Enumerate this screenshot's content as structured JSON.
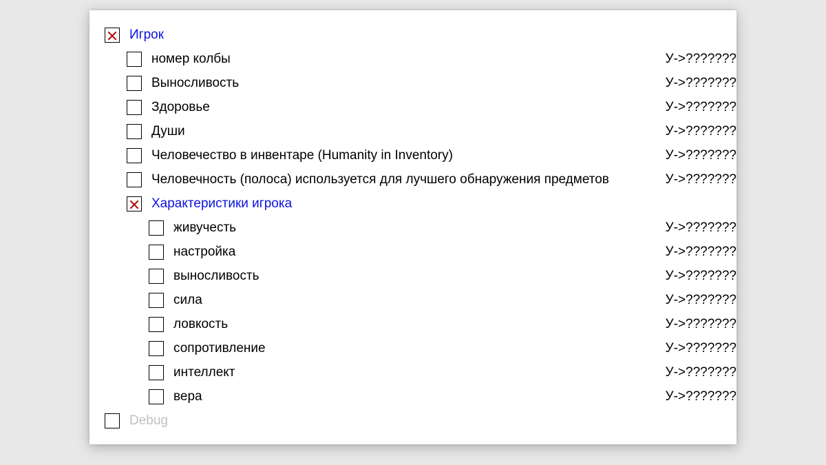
{
  "unknown_value": "У->???????",
  "tree": {
    "player": {
      "label": "Игрок",
      "checked": true,
      "items": [
        {
          "label": "номер колбы"
        },
        {
          "label": "Выносливость"
        },
        {
          "label": "Здоровье"
        },
        {
          "label": "Души"
        },
        {
          "label": "Человечество в инвентаре (Humanity in Inventory)"
        },
        {
          "label": "Человечность (полоса) используется для лучшего обнаружения предметов"
        }
      ],
      "stats": {
        "label": "Характеристики игрока",
        "checked": true,
        "items": [
          {
            "label": "живучесть"
          },
          {
            "label": "настройка"
          },
          {
            "label": "выносливость"
          },
          {
            "label": "сила"
          },
          {
            "label": "ловкость"
          },
          {
            "label": "сопротивление"
          },
          {
            "label": "интеллект"
          },
          {
            "label": "вера"
          }
        ]
      }
    },
    "debug": {
      "label": "Debug",
      "checked": false,
      "disabled": true
    }
  }
}
